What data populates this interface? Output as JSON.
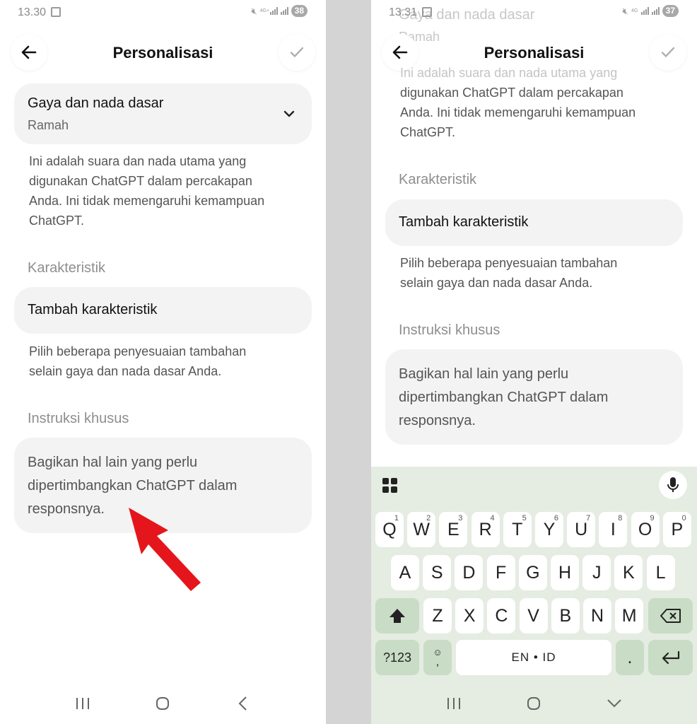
{
  "common": {
    "title": "Personalisasi"
  },
  "left": {
    "time": "13.30",
    "battery": "38",
    "network": "4G+",
    "style": {
      "title": "Gaya dan nada dasar",
      "value": "Ramah"
    },
    "style_desc": [
      "Ini adalah suara dan nada utama yang",
      "digunakan ChatGPT dalam percakapan",
      "Anda. Ini tidak memengaruhi kemampuan",
      "ChatGPT."
    ],
    "section_traits": "Karakteristik",
    "add_traits": "Tambah karakteristik",
    "traits_desc": [
      "Pilih beberapa penyesuaian tambahan",
      "selain gaya dan nada dasar Anda."
    ],
    "section_instructions": "Instruksi khusus",
    "instructions_placeholder": [
      "Bagikan hal lain yang perlu",
      "dipertimbangkan ChatGPT dalam",
      "responsnya."
    ]
  },
  "right": {
    "time": "13.31",
    "battery": "37",
    "network": "4G",
    "ghost_title": "Gaya dan nada dasar",
    "ghost_value": "Ramah",
    "style_desc": [
      "Ini adalah suara dan nada utama yang",
      "digunakan ChatGPT dalam percakapan",
      "Anda. Ini tidak memengaruhi kemampuan",
      "ChatGPT."
    ],
    "section_traits": "Karakteristik",
    "add_traits": "Tambah karakteristik",
    "traits_desc": [
      "Pilih beberapa penyesuaian tambahan",
      "selain gaya dan nada dasar Anda."
    ],
    "section_instructions": "Instruksi khusus",
    "instructions_placeholder": [
      "Bagikan hal lain yang perlu",
      "dipertimbangkan ChatGPT dalam",
      "responsnya."
    ]
  },
  "keyboard": {
    "row1": [
      {
        "k": "Q",
        "n": "1"
      },
      {
        "k": "W",
        "n": "2"
      },
      {
        "k": "E",
        "n": "3"
      },
      {
        "k": "R",
        "n": "4"
      },
      {
        "k": "T",
        "n": "5"
      },
      {
        "k": "Y",
        "n": "6"
      },
      {
        "k": "U",
        "n": "7"
      },
      {
        "k": "I",
        "n": "8"
      },
      {
        "k": "O",
        "n": "9"
      },
      {
        "k": "P",
        "n": "0"
      }
    ],
    "row2": [
      "A",
      "S",
      "D",
      "F",
      "G",
      "H",
      "J",
      "K",
      "L"
    ],
    "row3": [
      "Z",
      "X",
      "C",
      "V",
      "B",
      "N",
      "M"
    ],
    "sym_label": "?123",
    "space_label": "EN • ID",
    "period_label": ".",
    "comma_label": ","
  },
  "colors": {
    "arrow": "#e4161b",
    "keyboard_bg": "#e5ece2",
    "fn_key": "#c9dcc5"
  }
}
